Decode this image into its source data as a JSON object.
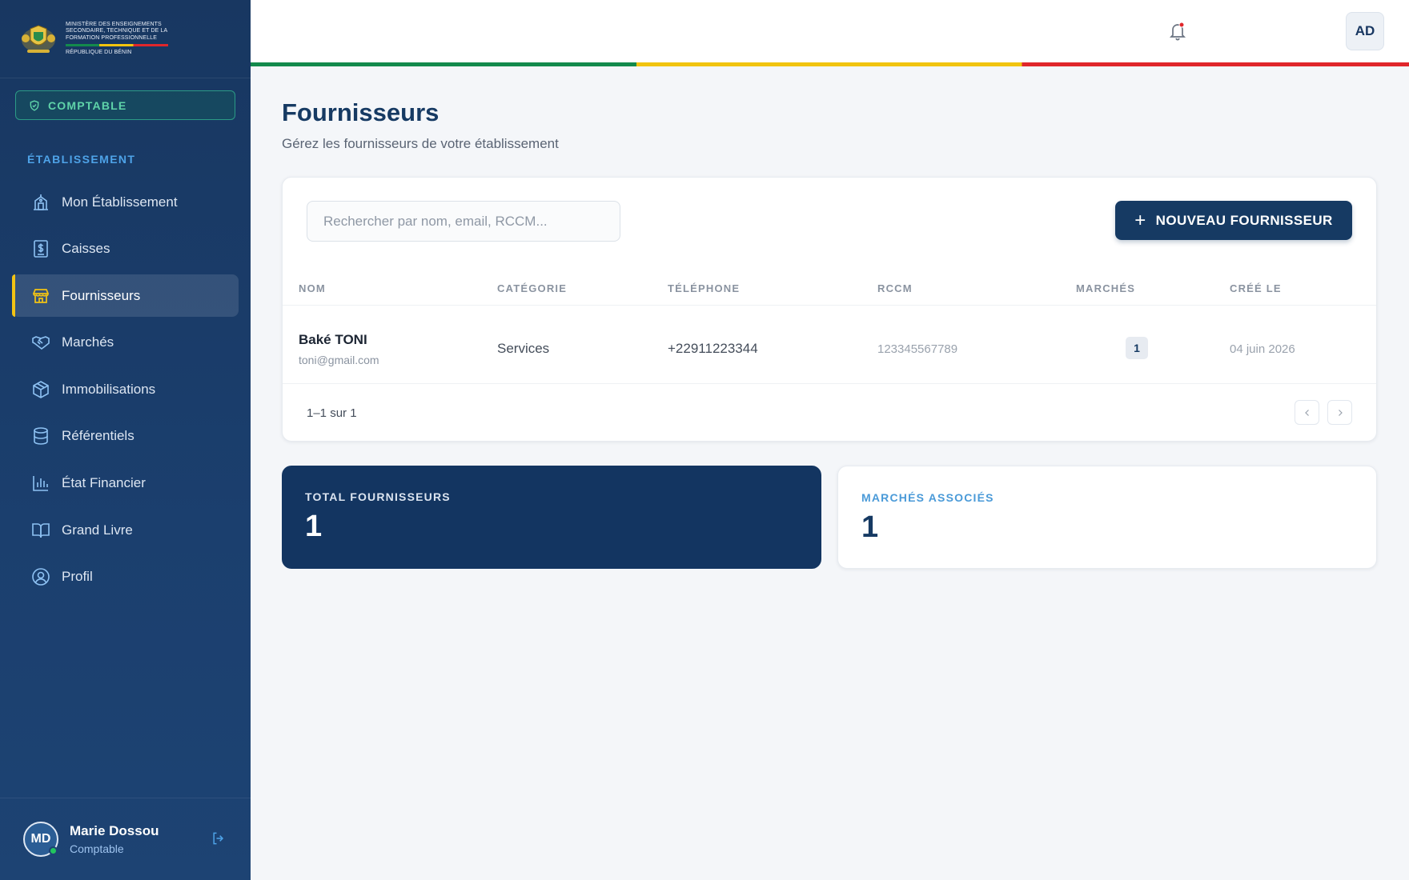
{
  "brand": {
    "ministry_line1": "Ministère des Enseignements",
    "ministry_line2": "Secondaire, Technique et de la",
    "ministry_line3": "Formation Professionnelle",
    "country": "République du Bénin"
  },
  "sidebar": {
    "role": "COMPTABLE",
    "section": "ÉTABLISSEMENT",
    "items": [
      {
        "label": "Mon Établissement",
        "icon": "building-icon"
      },
      {
        "label": "Caisses",
        "icon": "cash-register-icon"
      },
      {
        "label": "Fournisseurs",
        "icon": "store-icon",
        "active": true
      },
      {
        "label": "Marchés",
        "icon": "handshake-icon"
      },
      {
        "label": "Immobilisations",
        "icon": "box-icon"
      },
      {
        "label": "Référentiels",
        "icon": "database-icon"
      },
      {
        "label": "État Financier",
        "icon": "bar-chart-icon"
      },
      {
        "label": "Grand Livre",
        "icon": "book-icon"
      },
      {
        "label": "Profil",
        "icon": "user-circle-icon"
      }
    ],
    "user": {
      "initials": "MD",
      "name": "Marie Dossou",
      "role": "Comptable"
    }
  },
  "header": {
    "avatar_initials": "AD"
  },
  "main": {
    "title": "Fournisseurs",
    "subtitle": "Gérez les fournisseurs de votre établissement",
    "search_placeholder": "Rechercher par nom, email, RCCM...",
    "new_button": "NOUVEAU FOURNISSEUR",
    "columns": [
      "NOM",
      "CATÉGORIE",
      "TÉLÉPHONE",
      "RCCM",
      "MARCHÉS",
      "CRÉÉ LE"
    ],
    "rows": [
      {
        "name": "Baké TONI",
        "email": "toni@gmail.com",
        "category": "Services",
        "phone": "+22911223344",
        "rccm": "123345567789",
        "markets": "1",
        "created": "04 juin 2026"
      }
    ],
    "pagination": "1–1 sur 1"
  },
  "stats": {
    "total_label": "TOTAL FOURNISSEURS",
    "total_value": "1",
    "markets_label": "MARCHÉS ASSOCIÉS",
    "markets_value": "1"
  },
  "colors": {
    "sidebar": "#183761",
    "accent": "#163a63",
    "active_marker": "#f2c314",
    "flag_green": "#138a4c",
    "flag_yellow": "#f1c40f",
    "flag_red": "#e0262b"
  }
}
